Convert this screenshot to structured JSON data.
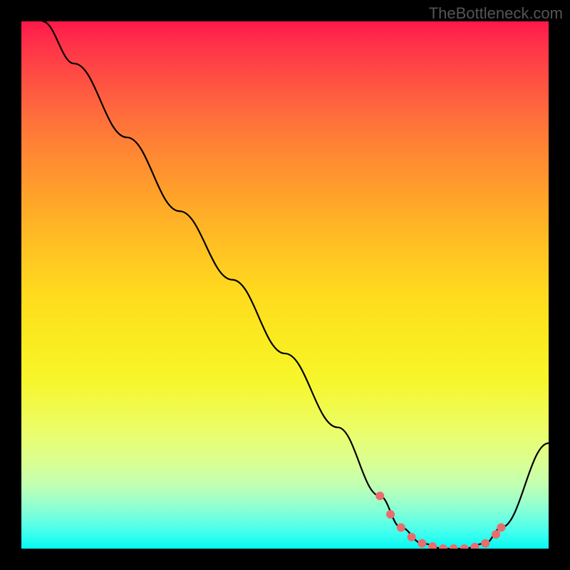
{
  "watermark": "TheBottleneck.com",
  "chart_data": {
    "type": "line",
    "title": "",
    "xlabel": "",
    "ylabel": "",
    "xlim": [
      0,
      100
    ],
    "ylim": [
      0,
      100
    ],
    "grid": false,
    "legend": false,
    "series": [
      {
        "name": "bottleneck-curve",
        "x": [
          4,
          10,
          20,
          30,
          40,
          50,
          60,
          68,
          72,
          76,
          80,
          84,
          88,
          91,
          100
        ],
        "y": [
          100,
          92,
          78,
          64,
          51,
          37,
          23,
          10,
          4,
          1,
          0,
          0,
          1,
          4,
          20
        ]
      }
    ],
    "markers": {
      "name": "optimal-region",
      "x": [
        68,
        70,
        72,
        74,
        76,
        78,
        80,
        82,
        84,
        86,
        88,
        90,
        91
      ],
      "y": [
        10,
        6.5,
        4,
        2.2,
        1,
        0.4,
        0,
        0,
        0,
        0.3,
        1,
        2.7,
        4
      ]
    },
    "gradient": {
      "colors": [
        "#ff184a",
        "#ffa22a",
        "#f7f62b",
        "#05f9f2"
      ],
      "positions": [
        0,
        33,
        68,
        100
      ],
      "direction": "vertical"
    }
  }
}
